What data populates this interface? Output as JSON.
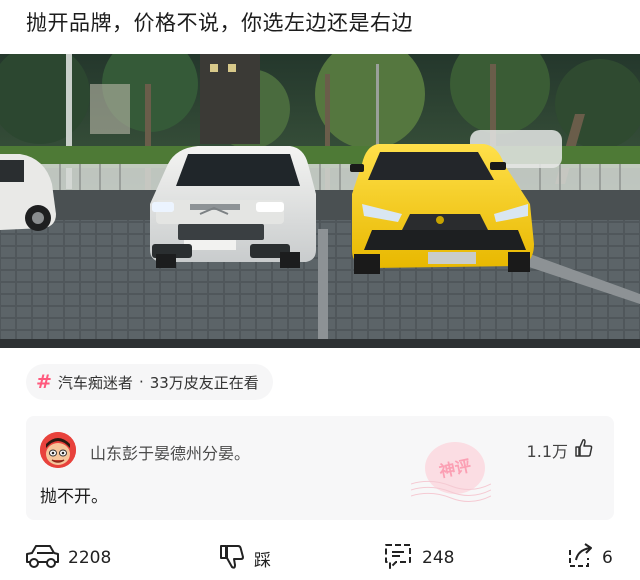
{
  "post": {
    "title": "抛开品牌，价格不说，你选左边还是右边"
  },
  "topic": {
    "icon": "hashtag-icon",
    "name": "汽车痴迷者",
    "separator": "·",
    "viewers": "33万皮友正在看"
  },
  "comment": {
    "badge": "神评",
    "username": "山东彭于晏德州分晏。",
    "text": "抛不开。",
    "likes": "1.1万"
  },
  "actions": {
    "share_count": "2208",
    "dislike_label": "踩",
    "comment_count": "248",
    "last_count": "6"
  },
  "colors": {
    "accent": "#ff5a7e",
    "card_bg": "#f7f7f8"
  }
}
